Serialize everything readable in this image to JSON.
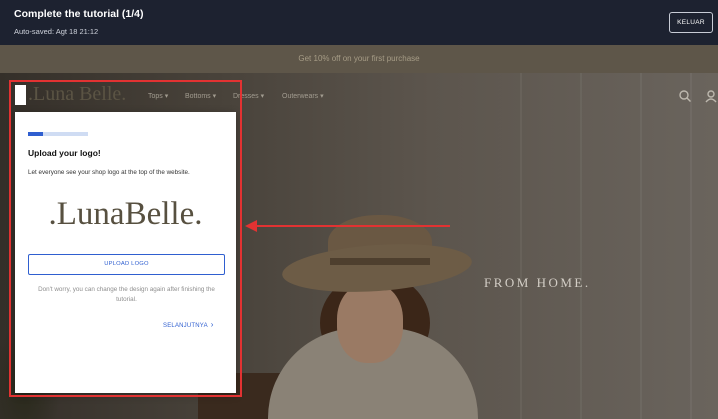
{
  "tutorial": {
    "title": "Complete the tutorial (1/4)",
    "autosave": "Auto-saved: Agt 18 21:12",
    "exit_label": "KELUAR",
    "step_progress": 0.25
  },
  "store": {
    "promo_text": "Get 10% off on your first purchase",
    "logo_text": ".Luna Belle.",
    "nav_items": [
      "Tops ▾",
      "Bottoms ▾",
      "Dresses ▾",
      "Outerwears ▾"
    ],
    "hero_text": "FROM HOME.",
    "icons": [
      "search-icon",
      "user-icon"
    ]
  },
  "card": {
    "title": "Upload your logo!",
    "description": "Let everyone see your shop logo at the top of the website.",
    "logo_preview": ".LunaBelle.",
    "upload_label": "UPLOAD LOGO",
    "note": "Don't worry, you can change the design again after finishing the tutorial.",
    "next_label": "SELANJUTNYA",
    "next_icon": "chevron-right-icon"
  },
  "colors": {
    "accent": "#2f5fd0",
    "highlight": "#e23232",
    "topbar": "#1d2230"
  }
}
